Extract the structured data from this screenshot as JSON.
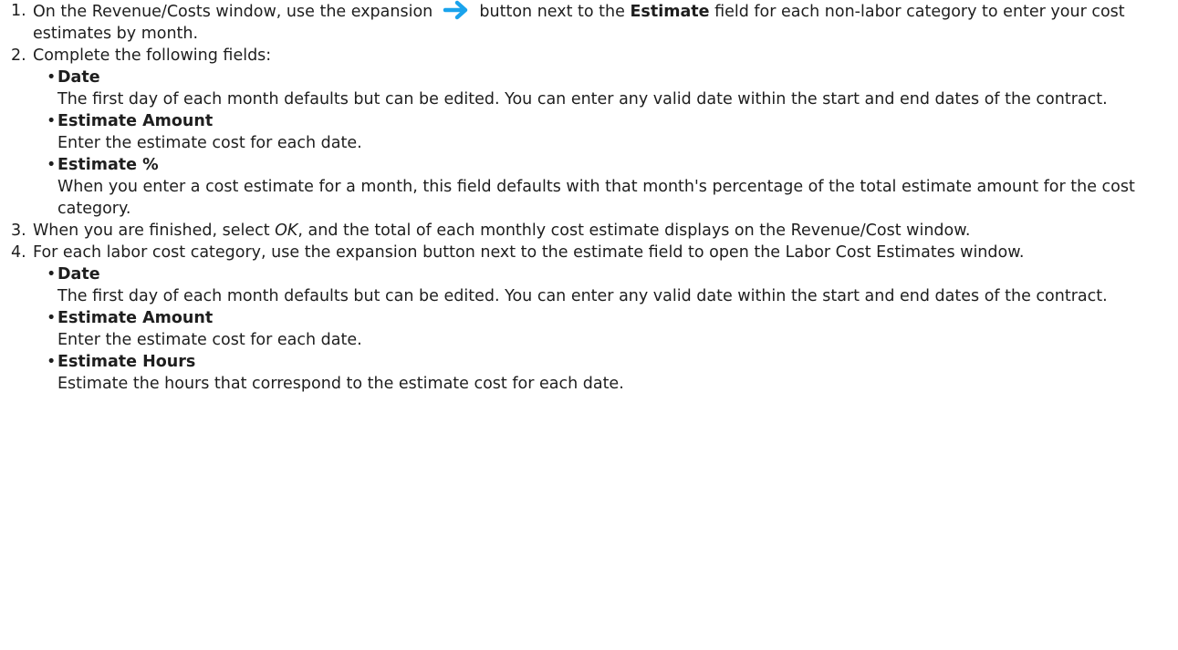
{
  "colors": {
    "text": "#1e1e1e",
    "arrow_icon": "#1aa3ec"
  },
  "icons": {
    "expansion": "arrow-right-icon"
  },
  "steps": [
    {
      "number": "1.",
      "text_before": "On the Revenue/Costs window, use the expansion",
      "text_middle": "button next to the",
      "field": "Estimate",
      "text_after": "field for each non-labor category to enter your cost estimates by month."
    },
    {
      "number": "2.",
      "text": "Complete the following fields:",
      "items": [
        {
          "term": "Date",
          "desc": "The first day of each month defaults but can be edited. You can enter any valid date within the start and end dates of the contract."
        },
        {
          "term": "Estimate Amount",
          "desc": "Enter the estimate cost for each date."
        },
        {
          "term": "Estimate %",
          "desc": "When you enter a cost estimate for a month, this field defaults with that month's percentage of the total estimate amount for the cost category."
        }
      ]
    },
    {
      "number": "3.",
      "text_before": "When you are finished, select",
      "ui_label": "OK",
      "text_after": ", and the total of each monthly cost estimate displays on the Revenue/Cost window."
    },
    {
      "number": "4.",
      "text": "For each labor cost category, use the expansion button next to the estimate field to open the Labor Cost Estimates window.",
      "items": [
        {
          "term": "Date",
          "desc": "The first day of each month defaults but can be edited. You can enter any valid date within the start and end dates of the contract."
        },
        {
          "term": "Estimate Amount",
          "desc": "Enter the estimate cost for each date."
        },
        {
          "term": "Estimate Hours",
          "desc": "Estimate the hours that correspond to the estimate cost for each date."
        }
      ]
    }
  ]
}
